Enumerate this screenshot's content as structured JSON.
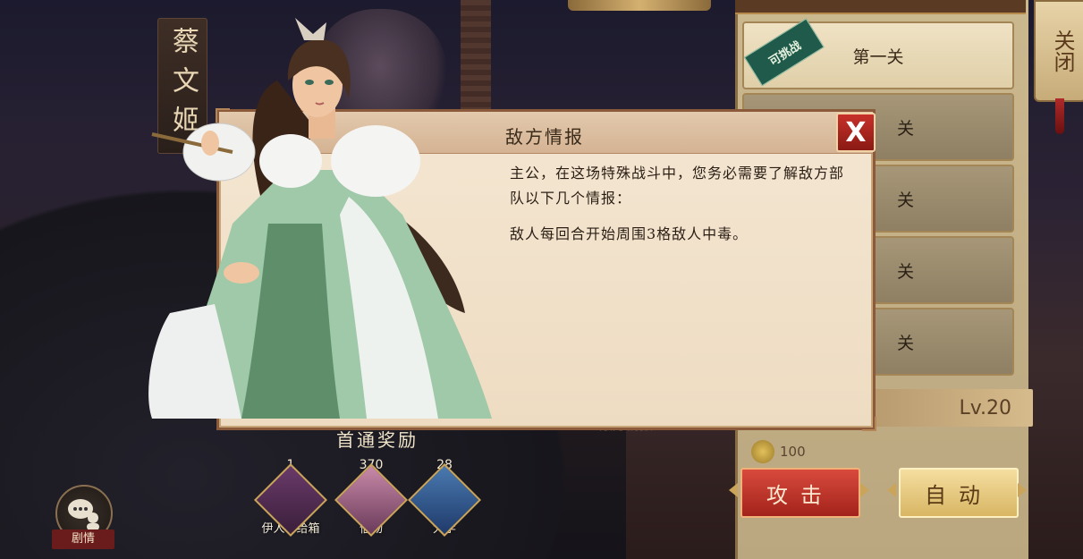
{
  "background": {
    "hero_name": "蔡文姬"
  },
  "stage_list": {
    "challenge_tag": "可挑战",
    "items": [
      {
        "label": "第一关",
        "locked": false
      },
      {
        "label": "关",
        "locked": true
      },
      {
        "label": "关",
        "locked": true
      },
      {
        "label": "关",
        "locked": true
      },
      {
        "label": "关",
        "locked": true
      }
    ],
    "level": "Lv.20",
    "cost": "100",
    "attack_label": "攻击",
    "auto_label": "自动",
    "side_scroll": "关闭"
  },
  "rewards": {
    "title": "首通奖励",
    "items": [
      {
        "count": "1",
        "name": "伊人补给箱"
      },
      {
        "count": "370",
        "name": "信物"
      },
      {
        "count": "28",
        "name": "大学"
      }
    ],
    "ghost_text": "敌方情报"
  },
  "story": {
    "label": "剧情"
  },
  "modal": {
    "title": "敌方情报",
    "close_label": "X",
    "paragraph1": "主公，在这场特殊战斗中，您务必需要了解敌方部队以下几个情报：",
    "paragraph2": "敌人每回合开始周围3格敌人中毒。"
  },
  "colors": {
    "modal_bg": "#f4e6d2",
    "close_red": "#c8302a",
    "attack_red": "#d84a3c",
    "auto_gold": "#f5dea0"
  }
}
